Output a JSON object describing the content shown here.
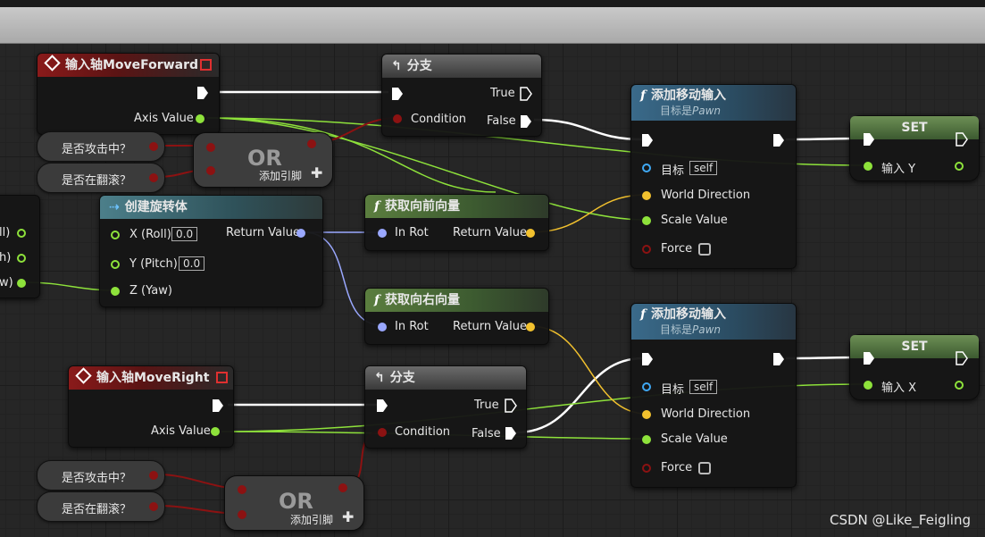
{
  "nodes": {
    "input_forward": {
      "title": "输入轴MoveForward",
      "axis_label": "Axis Value"
    },
    "branch1": {
      "title": "分支",
      "true_label": "True",
      "false_label": "False",
      "condition_label": "Condition"
    },
    "var_attacking_1": {
      "label": "是否攻击中？"
    },
    "var_rolling_1": {
      "label": "是否在翻滚？"
    },
    "or1": {
      "title": "OR",
      "add_pin": "添加引脚"
    },
    "add_move_1": {
      "title": "添加移动输入",
      "subtitle_prefix": "目标是",
      "subtitle_target": "Pawn",
      "target_label": "目标",
      "self_value": "self",
      "world_direction": "World Direction",
      "scale_value": "Scale Value",
      "force": "Force"
    },
    "set1": {
      "title": "SET",
      "pin_label": "输入 Y"
    },
    "make_rotator": {
      "title": "创建旋转体",
      "x_label": "X (Roll)",
      "x_value": "0.0",
      "y_label": "Y (Pitch)",
      "y_value": "0.0",
      "z_label": "Z (Yaw)",
      "return_label": "Return Value"
    },
    "get_forward": {
      "title": "获取向前向量",
      "in_label": "In Rot",
      "return_label": "Return Value"
    },
    "get_right": {
      "title": "获取向右向量",
      "in_label": "In Rot",
      "return_label": "Return Value"
    },
    "left_partial": {
      "pin1": "ll)",
      "pin2": "h)",
      "pin3": "w)"
    },
    "input_right": {
      "title": "输入轴MoveRight",
      "axis_label": "Axis Value"
    },
    "branch2": {
      "title": "分支",
      "true_label": "True",
      "false_label": "False",
      "condition_label": "Condition"
    },
    "var_attacking_2": {
      "label": "是否攻击中？"
    },
    "var_rolling_2": {
      "label": "是否在翻滚？"
    },
    "or2": {
      "title": "OR",
      "add_pin": "添加引脚"
    },
    "add_move_2": {
      "title": "添加移动输入",
      "subtitle_prefix": "目标是",
      "subtitle_target": "Pawn",
      "target_label": "目标",
      "self_value": "self",
      "world_direction": "World Direction",
      "scale_value": "Scale Value",
      "force": "Force"
    },
    "set2": {
      "title": "SET",
      "pin_label": "输入 X"
    }
  },
  "watermark": "CSDN @Like_Feigling",
  "colors": {
    "exec": "#ffffff",
    "bool": "#8c1212",
    "float": "#8ee23b",
    "vector": "#f2c12e",
    "rotator": "#9aa8ff",
    "object": "#3fa9f5"
  }
}
